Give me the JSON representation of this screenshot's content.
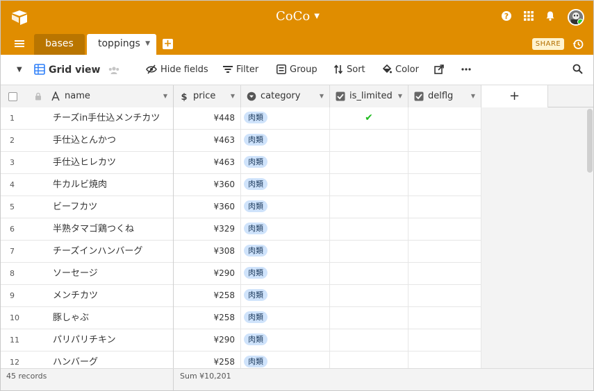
{
  "app": {
    "base_name": "CoCo",
    "colors": {
      "accent": "#e08d00",
      "tag_bg": "#cfe3fb",
      "check": "#1fbb1f"
    }
  },
  "tabs": [
    {
      "label": "bases",
      "active": false
    },
    {
      "label": "toppings",
      "active": true
    }
  ],
  "share_label": "SHARE",
  "toolbar": {
    "view_name": "Grid view",
    "hide_fields": "Hide fields",
    "filter": "Filter",
    "group": "Group",
    "sort": "Sort",
    "color": "Color"
  },
  "columns": [
    {
      "label": "name",
      "icon": "text-icon"
    },
    {
      "label": "price",
      "icon": "currency-icon"
    },
    {
      "label": "category",
      "icon": "single-select-icon"
    },
    {
      "label": "is_limited",
      "icon": "checkbox-icon"
    },
    {
      "label": "delflg",
      "icon": "checkbox-icon"
    }
  ],
  "add_field": "+",
  "rows": [
    {
      "num": "1",
      "name": "チーズin手仕込メンチカツ",
      "price": "¥448",
      "category": "肉類",
      "is_limited": "✔"
    },
    {
      "num": "2",
      "name": "手仕込とんかつ",
      "price": "¥463",
      "category": "肉類",
      "is_limited": ""
    },
    {
      "num": "3",
      "name": "手仕込ヒレカツ",
      "price": "¥463",
      "category": "肉類",
      "is_limited": ""
    },
    {
      "num": "4",
      "name": "牛カルビ焼肉",
      "price": "¥360",
      "category": "肉類",
      "is_limited": ""
    },
    {
      "num": "5",
      "name": "ビーフカツ",
      "price": "¥360",
      "category": "肉類",
      "is_limited": ""
    },
    {
      "num": "6",
      "name": "半熟タマゴ鶏つくね",
      "price": "¥329",
      "category": "肉類",
      "is_limited": ""
    },
    {
      "num": "7",
      "name": "チーズインハンバーグ",
      "price": "¥308",
      "category": "肉類",
      "is_limited": ""
    },
    {
      "num": "8",
      "name": "ソーセージ",
      "price": "¥290",
      "category": "肉類",
      "is_limited": ""
    },
    {
      "num": "9",
      "name": "メンチカツ",
      "price": "¥258",
      "category": "肉類",
      "is_limited": ""
    },
    {
      "num": "10",
      "name": "豚しゃぶ",
      "price": "¥258",
      "category": "肉類",
      "is_limited": ""
    },
    {
      "num": "11",
      "name": "パリパリチキン",
      "price": "¥290",
      "category": "肉類",
      "is_limited": ""
    },
    {
      "num": "12",
      "name": "ハンバーグ",
      "price": "¥258",
      "category": "肉類",
      "is_limited": ""
    }
  ],
  "footer": {
    "records": "45 records",
    "sum": "Sum ¥10,201"
  }
}
